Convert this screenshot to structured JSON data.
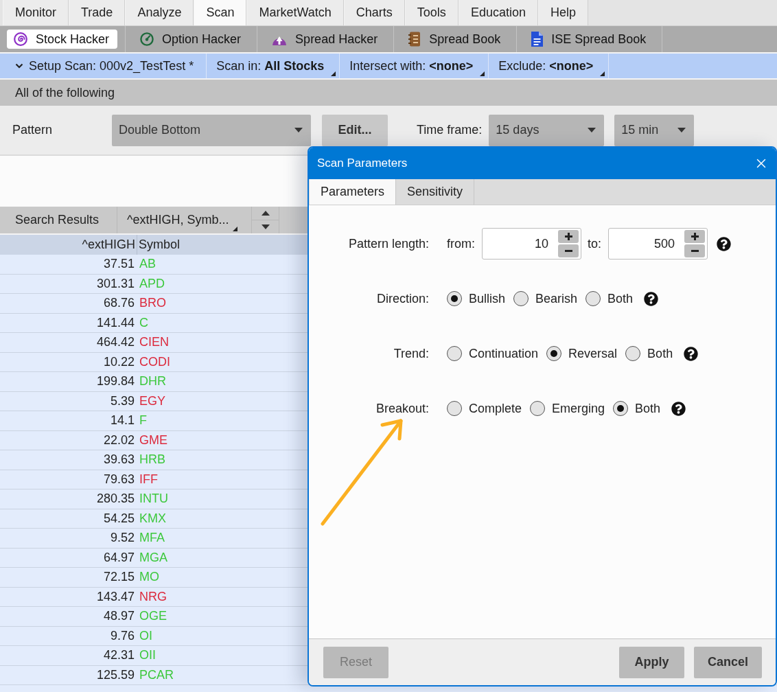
{
  "menu_tabs": [
    {
      "label": "Monitor",
      "selected": false
    },
    {
      "label": "Trade",
      "selected": false
    },
    {
      "label": "Analyze",
      "selected": false
    },
    {
      "label": "Scan",
      "selected": true
    },
    {
      "label": "MarketWatch",
      "selected": false
    },
    {
      "label": "Charts",
      "selected": false
    },
    {
      "label": "Tools",
      "selected": false
    },
    {
      "label": "Education",
      "selected": false
    },
    {
      "label": "Help",
      "selected": false
    }
  ],
  "hacker_tabs": [
    {
      "label": "Stock Hacker",
      "selected": true
    },
    {
      "label": "Option Hacker",
      "selected": false
    },
    {
      "label": "Spread Hacker",
      "selected": false
    },
    {
      "label": "Spread Book",
      "selected": false
    },
    {
      "label": "ISE Spread Book",
      "selected": false
    }
  ],
  "scan_bar": [
    {
      "kind": "collapse",
      "text": "Setup Scan: 000v2_TestTest *"
    },
    {
      "kind": "menu",
      "text": "Scan in: **All Stocks**"
    },
    {
      "kind": "menu",
      "text": "Intersect with: **<none>**"
    },
    {
      "kind": "menu",
      "text": "Exclude: **<none>**"
    }
  ],
  "group_header": "All of the following",
  "criteria": {
    "label": "Pattern",
    "pattern": "Double Bottom",
    "edit_button": "Edit...",
    "time_frame_label": "Time frame:",
    "time_frame": "15 days",
    "interval": "15 min"
  },
  "results": {
    "tab": "Search Results",
    "sort": "^extHIGH, Symb...",
    "columns": [
      "^extHIGH",
      "Symbol"
    ],
    "rows": [
      {
        "value": "37.51",
        "symbol": "AB",
        "color": "#3cc83c"
      },
      {
        "value": "301.31",
        "symbol": "APD",
        "color": "#3cc83c"
      },
      {
        "value": "68.76",
        "symbol": "BRO",
        "color": "#dc2b3e"
      },
      {
        "value": "141.44",
        "symbol": "C",
        "color": "#3cc83c"
      },
      {
        "value": "464.42",
        "symbol": "CIEN",
        "color": "#dc2b3e"
      },
      {
        "value": "10.22",
        "symbol": "CODI",
        "color": "#dc2b3e"
      },
      {
        "value": "199.84",
        "symbol": "DHR",
        "color": "#3cc83c"
      },
      {
        "value": "5.39",
        "symbol": "EGY",
        "color": "#dc2b3e"
      },
      {
        "value": "14.1",
        "symbol": "F",
        "color": "#3cc83c"
      },
      {
        "value": "22.02",
        "symbol": "GME",
        "color": "#dc2b3e"
      },
      {
        "value": "39.63",
        "symbol": "HRB",
        "color": "#3cc83c"
      },
      {
        "value": "79.63",
        "symbol": "IFF",
        "color": "#dc2b3e"
      },
      {
        "value": "280.35",
        "symbol": "INTU",
        "color": "#3cc83c"
      },
      {
        "value": "54.25",
        "symbol": "KMX",
        "color": "#3cc83c"
      },
      {
        "value": "9.52",
        "symbol": "MFA",
        "color": "#3cc83c"
      },
      {
        "value": "64.97",
        "symbol": "MGA",
        "color": "#3cc83c"
      },
      {
        "value": "72.15",
        "symbol": "MO",
        "color": "#3cc83c"
      },
      {
        "value": "143.47",
        "symbol": "NRG",
        "color": "#dc2b3e"
      },
      {
        "value": "48.97",
        "symbol": "OGE",
        "color": "#3cc83c"
      },
      {
        "value": "9.76",
        "symbol": "OI",
        "color": "#3cc83c"
      },
      {
        "value": "42.31",
        "symbol": "OII",
        "color": "#3cc83c"
      },
      {
        "value": "125.59",
        "symbol": "PCAR",
        "color": "#3cc83c"
      }
    ]
  },
  "dialog": {
    "title": "Scan Parameters",
    "tabs": [
      {
        "label": "Parameters",
        "selected": true
      },
      {
        "label": "Sensitivity",
        "selected": false
      }
    ],
    "pattern_length": {
      "label": "Pattern length:",
      "from_label": "from:",
      "from": "10",
      "to_label": "to:",
      "to": "500"
    },
    "options": [
      {
        "label": "Direction:",
        "choices": [
          {
            "label": "Bullish",
            "selected": true
          },
          {
            "label": "Bearish",
            "selected": false
          },
          {
            "label": "Both",
            "selected": false
          }
        ]
      },
      {
        "label": "Trend:",
        "choices": [
          {
            "label": "Continuation",
            "selected": false
          },
          {
            "label": "Reversal",
            "selected": true
          },
          {
            "label": "Both",
            "selected": false
          }
        ]
      },
      {
        "label": "Breakout:",
        "choices": [
          {
            "label": "Complete",
            "selected": false
          },
          {
            "label": "Emerging",
            "selected": false
          },
          {
            "label": "Both",
            "selected": true
          }
        ]
      }
    ],
    "buttons": [
      {
        "label": "Reset",
        "disabled": true
      },
      {
        "label": "Apply",
        "disabled": false
      },
      {
        "label": "Cancel",
        "disabled": false
      }
    ]
  },
  "annotations": [
    {
      "kind": "arrow"
    }
  ]
}
